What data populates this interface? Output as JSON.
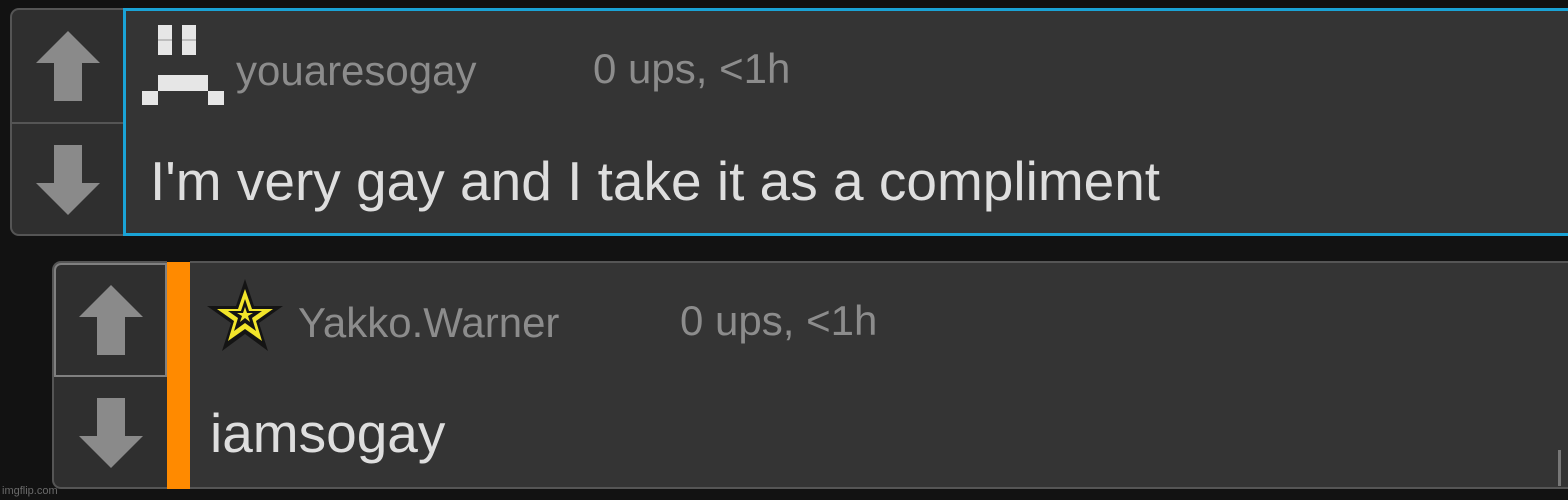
{
  "comments": [
    {
      "username": "youaresogay",
      "meta": "0 ups, <1h",
      "text": "I'm very gay and I take it as a compliment",
      "avatar_icon": "sad-face-pixel-icon",
      "selected_border_color": "#1aa3d6"
    },
    {
      "username": "Yakko.Warner",
      "meta": "0 ups, <1h",
      "text": "iamsogay",
      "avatar_icon": "star-icon",
      "reply_bar_color": "#ff8a00",
      "star_color": "#f2e52a"
    }
  ],
  "watermark": "imgflip.com"
}
